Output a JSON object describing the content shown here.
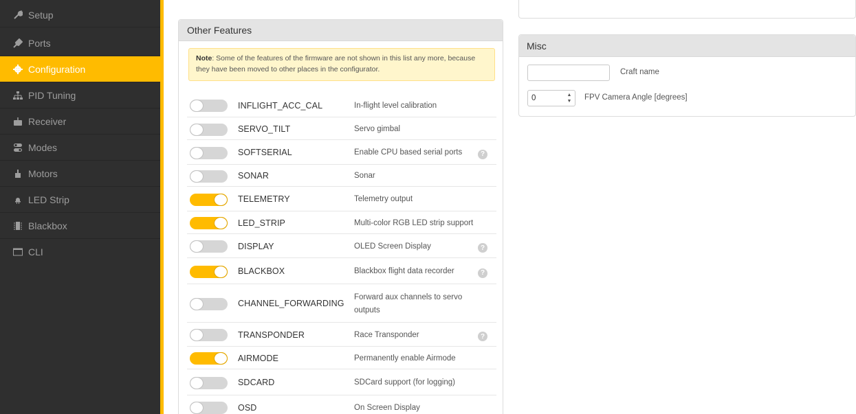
{
  "sidebar": {
    "accent_color": "#ffbb00",
    "items": [
      {
        "label": "Setup",
        "icon": "wrench-icon",
        "active": false
      },
      {
        "label": "Ports",
        "icon": "plug-icon",
        "active": false
      },
      {
        "label": "Configuration",
        "icon": "gear-icon",
        "active": true
      },
      {
        "label": "PID Tuning",
        "icon": "sitemap-icon",
        "active": false
      },
      {
        "label": "Receiver",
        "icon": "receiver-icon",
        "active": false
      },
      {
        "label": "Modes",
        "icon": "toggles-icon",
        "active": false
      },
      {
        "label": "Motors",
        "icon": "motor-icon",
        "active": false
      },
      {
        "label": "LED Strip",
        "icon": "led-icon",
        "active": false
      },
      {
        "label": "Blackbox",
        "icon": "blackbox-icon",
        "active": false
      },
      {
        "label": "CLI",
        "icon": "terminal-icon",
        "active": false
      }
    ]
  },
  "other_features": {
    "title": "Other Features",
    "note_bold": "Note",
    "note_text": ": Some of the features of the firmware are not shown in this list any more, because they have been moved to other places in the configurator.",
    "features": [
      {
        "name": "INFLIGHT_ACC_CAL",
        "desc": "In-flight level calibration",
        "enabled": false,
        "help": false
      },
      {
        "name": "SERVO_TILT",
        "desc": "Servo gimbal",
        "enabled": false,
        "help": false
      },
      {
        "name": "SOFTSERIAL",
        "desc": "Enable CPU based serial ports",
        "enabled": false,
        "help": true
      },
      {
        "name": "SONAR",
        "desc": "Sonar",
        "enabled": false,
        "help": false
      },
      {
        "name": "TELEMETRY",
        "desc": "Telemetry output",
        "enabled": true,
        "help": false
      },
      {
        "name": "LED_STRIP",
        "desc": "Multi-color RGB LED strip support",
        "enabled": true,
        "help": false
      },
      {
        "name": "DISPLAY",
        "desc": "OLED Screen Display",
        "enabled": false,
        "help": true
      },
      {
        "name": "BLACKBOX",
        "desc": "Blackbox flight data recorder",
        "enabled": true,
        "help": true
      },
      {
        "name": "CHANNEL_FORWARDING",
        "desc": "Forward aux channels to servo outputs",
        "enabled": false,
        "help": false
      },
      {
        "name": "TRANSPONDER",
        "desc": "Race Transponder",
        "enabled": false,
        "help": true
      },
      {
        "name": "AIRMODE",
        "desc": "Permanently enable Airmode",
        "enabled": true,
        "help": false
      },
      {
        "name": "SDCARD",
        "desc": "SDCard support (for logging)",
        "enabled": false,
        "help": false
      },
      {
        "name": "OSD",
        "desc": "On Screen Display",
        "enabled": false,
        "help": false
      }
    ]
  },
  "misc": {
    "title": "Misc",
    "craft_name_value": "",
    "craft_name_label": "Craft name",
    "camera_angle_value": "0",
    "camera_angle_label": "FPV Camera Angle [degrees]"
  },
  "help_glyph": "?"
}
